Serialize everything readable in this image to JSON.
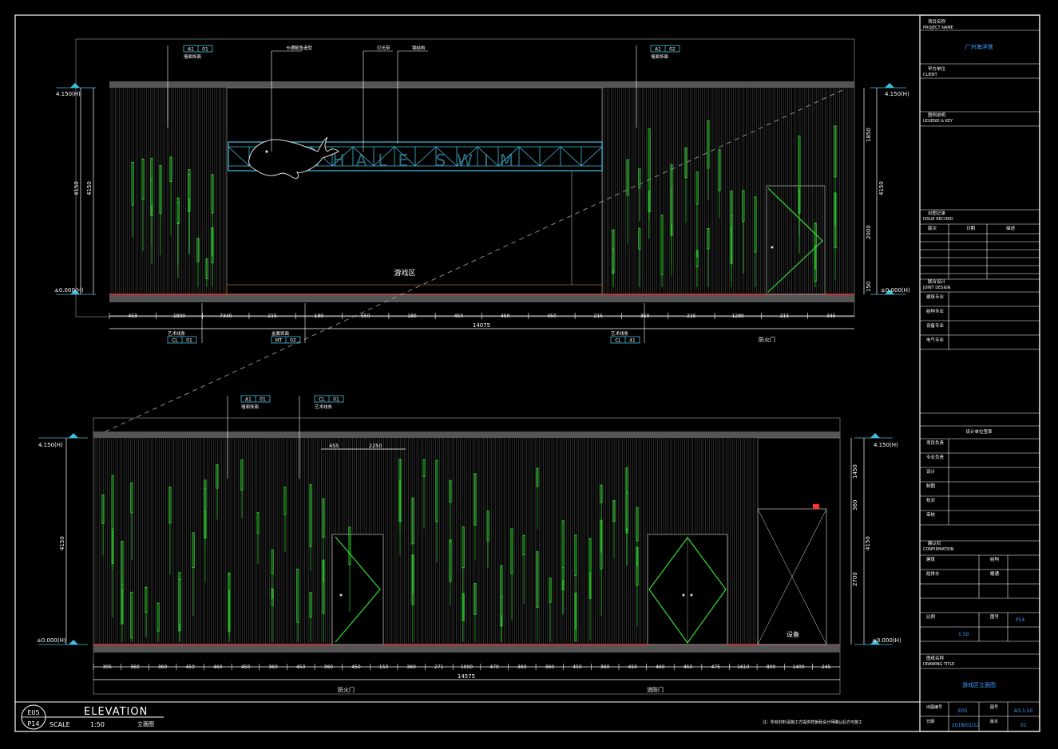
{
  "drawing": {
    "elevation_title": "ELEVATION",
    "elevation_title_cn": "立面图",
    "scale_label": "SCALE",
    "scale_value": "1:50",
    "sheet_code_top": "E05",
    "sheet_code_bottom": "P14",
    "note": "注：所有材料请施工方提供样板经设计师确认后方可施工"
  },
  "upper_elevation": {
    "total_width": "14075",
    "dims": [
      "453",
      "1800",
      "7340",
      "215",
      "180",
      "550",
      "180",
      "450",
      "450",
      "450",
      "215",
      "350",
      "215",
      "1280",
      "215",
      "345"
    ],
    "room_label": "游戏区",
    "level_top": "4.150(H)",
    "level_bottom": "±0.000(H)",
    "level_top_right": "4.150(H)",
    "level_bottom_right": "±0.000(H)",
    "height_total": "4150",
    "height_upper": "1850",
    "height_lower": "2000",
    "height_base": "150",
    "callouts": [
      {
        "code_a": "A1",
        "code_b": "01",
        "label": "墙面饰面"
      },
      {
        "code_a": "A1",
        "code_b": "02",
        "label": "墙面饰面"
      },
      {
        "code_a": "CL",
        "code_b": "01",
        "label": "艺术线条"
      },
      {
        "code_a": "MT",
        "code_b": "02",
        "label": "金属饰面"
      },
      {
        "code_a": "CL",
        "code_b": "41",
        "label": "艺术线条"
      }
    ],
    "leaders": [
      "卡通鲸鱼造型",
      "灯光带",
      "钢结构"
    ],
    "sign_text": "WHALE SWIM",
    "door_label": "防火门"
  },
  "lower_elevation": {
    "total_width": "14575",
    "dims": [
      "395",
      "360",
      "360",
      "450",
      "460",
      "450",
      "360",
      "450",
      "360",
      "450",
      "150",
      "360",
      "271",
      "1000",
      "470",
      "360",
      "360",
      "450",
      "360",
      "450",
      "460",
      "450",
      "475",
      "1610",
      "800",
      "1400",
      "245"
    ],
    "level_top": "4.150(H)",
    "level_bottom": "±0.000(H)",
    "level_top_right": "4.150(H)",
    "level_bottom_right": "±0.000(H)",
    "height_total": "4150",
    "height_upper": "1450",
    "height_mid": "360",
    "height_lower": "2700",
    "callouts": [
      {
        "code_a": "A1",
        "code_b": "01",
        "label": "墙面饰面"
      },
      {
        "code_a": "CL",
        "code_b": "01",
        "label": "艺术线条"
      }
    ],
    "top_dims": [
      "455",
      "2250"
    ],
    "door_labels": [
      "防火门",
      "消防门"
    ],
    "cabinet_label": "设备"
  },
  "title_block": {
    "project_name_label": "项目名称",
    "project_name_en": "PROJECT NAME",
    "project_name": "广州海洋馆",
    "client_label": "甲方单位",
    "client_en": "CLIENT",
    "legend_label": "图例说明",
    "legend_en": "LEGEND & KEY",
    "issue_label": "出图记录",
    "issue_en": "ISSUE RECORD",
    "issue_cols": [
      "版次",
      "日期",
      "描述"
    ],
    "joint_label": "联合设计",
    "joint_en": "JOINT DESIGN",
    "joint_rows": [
      "建筑专业",
      "结构专业",
      "设备专业",
      "电气专业"
    ],
    "signature_title": "设计单位签章",
    "signature_rows": [
      "项目负责",
      "专业负责",
      "设计",
      "制图",
      "校对",
      "审核"
    ],
    "confirm_label": "确认栏",
    "confirm_en": "CONFIRMATION",
    "confirm_rows": [
      "建筑",
      "结构",
      "给排水",
      "暖通"
    ],
    "scale_row": {
      "label": "比例",
      "value": "1:50",
      "label2": "图号",
      "value2": "P14"
    },
    "drawing_title_label": "图纸名称",
    "drawing_title_en": "DRAWING TITLE",
    "drawing_title": "游戏区立面图",
    "bottom_row": {
      "label1": "出图编号",
      "value1": "E05",
      "label2": "图号",
      "value2": "A3-1:50",
      "label3": "日期",
      "value3": "2018/01/12",
      "label4": "版本",
      "value4": "01"
    }
  }
}
